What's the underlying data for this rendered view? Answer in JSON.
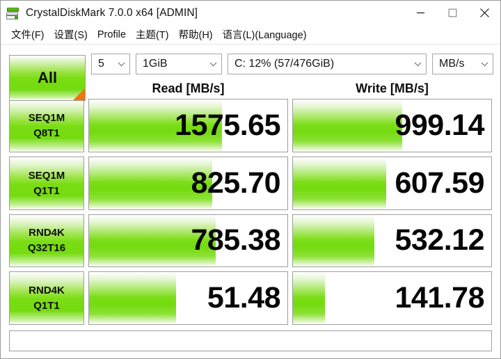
{
  "window": {
    "title": "CrystalDiskMark 7.0.0 x64 [ADMIN]",
    "icon": "crystaldiskmark-icon",
    "controls": {
      "minimize": "minimize-button",
      "maximize": "maximize-button",
      "close": "close-button"
    }
  },
  "menu": {
    "items": [
      {
        "label": "文件(F)"
      },
      {
        "label": "设置(S)"
      },
      {
        "label": "Profile"
      },
      {
        "label": "主题(T)"
      },
      {
        "label": "帮助(H)"
      },
      {
        "label": "语言(L)(Language)"
      }
    ]
  },
  "toolbar": {
    "all_button": "All",
    "count": "5",
    "size": "1GiB",
    "drive": "C: 12% (57/476GiB)",
    "unit": "MB/s"
  },
  "columns": {
    "read": "Read [MB/s]",
    "write": "Write [MB/s]"
  },
  "chart_data": {
    "type": "bar",
    "title": "CrystalDiskMark 7.0.0 x64 [ADMIN]",
    "xlabel": "",
    "ylabel": "",
    "unit": "MB/s",
    "categories": [
      "SEQ1M Q8T1",
      "SEQ1M Q1T1",
      "RND4K Q32T16",
      "RND4K Q1T1"
    ],
    "series": [
      {
        "name": "Read [MB/s]",
        "values": [
          1575.65,
          825.7,
          785.38,
          51.48
        ]
      },
      {
        "name": "Write [MB/s]",
        "values": [
          999.14,
          607.59,
          532.12,
          141.78
        ]
      }
    ],
    "legend_position": "top",
    "grid": false
  },
  "rows": [
    {
      "name_line1": "SEQ1M",
      "name_line2": "Q8T1",
      "read": {
        "value": "1575.65",
        "fill_pct": 67
      },
      "write": {
        "value": "999.14",
        "fill_pct": 55
      }
    },
    {
      "name_line1": "SEQ1M",
      "name_line2": "Q1T1",
      "read": {
        "value": "825.70",
        "fill_pct": 62
      },
      "write": {
        "value": "607.59",
        "fill_pct": 47
      }
    },
    {
      "name_line1": "RND4K",
      "name_line2": "Q32T16",
      "read": {
        "value": "785.38",
        "fill_pct": 64
      },
      "write": {
        "value": "532.12",
        "fill_pct": 41
      }
    },
    {
      "name_line1": "RND4K",
      "name_line2": "Q1T1",
      "read": {
        "value": "51.48",
        "fill_pct": 44
      },
      "write": {
        "value": "141.78",
        "fill_pct": 16
      }
    }
  ],
  "status": {
    "comment": ""
  },
  "colors": {
    "accent_green": "#74db10",
    "accent_orange": "#ef7412",
    "border": "#9e9e9e",
    "text": "#0d0d0d"
  }
}
